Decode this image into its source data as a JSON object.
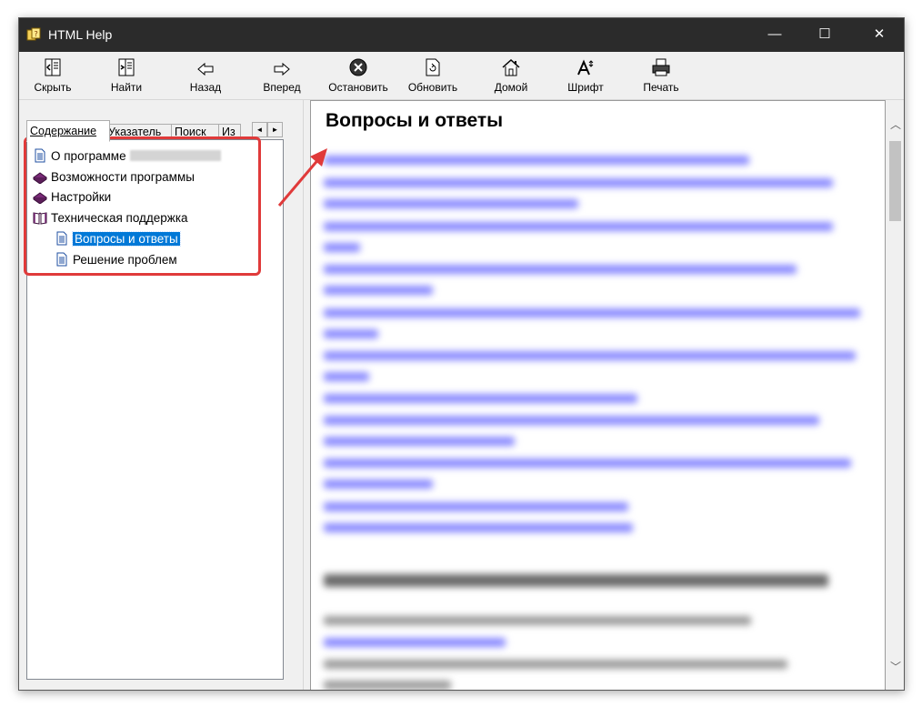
{
  "window": {
    "title": "HTML Help"
  },
  "titlebar": {
    "minimize": "—",
    "maximize": "☐",
    "close": "✕"
  },
  "toolbar": {
    "hide": "Скрыть",
    "find": "Найти",
    "back": "Назад",
    "forward": "Вперед",
    "stop": "Остановить",
    "refresh": "Обновить",
    "home": "Домой",
    "font": "Шрифт",
    "print": "Печать"
  },
  "tabs": {
    "contents": "Содержание",
    "index": "Указатель",
    "search": "Поиск",
    "favorites": "Из"
  },
  "tree": {
    "about": "О программе",
    "features": "Возможности программы",
    "settings": "Настройки",
    "support": "Техническая поддержка",
    "faq": "Вопросы и ответы",
    "troubleshooting": "Решение проблем"
  },
  "content": {
    "title": "Вопросы и ответы"
  },
  "colors": {
    "highlight": "#e03a3a",
    "selection": "#0078d7",
    "link": "#0000ee",
    "titlebar": "#2b2b2b"
  },
  "icons": [
    "app-help-icon",
    "hide-icon",
    "find-icon",
    "back-arrow-icon",
    "forward-arrow-icon",
    "stop-icon",
    "refresh-icon",
    "home-icon",
    "font-icon",
    "print-icon",
    "page-icon",
    "book-closed-icon",
    "book-open-icon",
    "chevron-up-icon",
    "chevron-down-icon"
  ]
}
